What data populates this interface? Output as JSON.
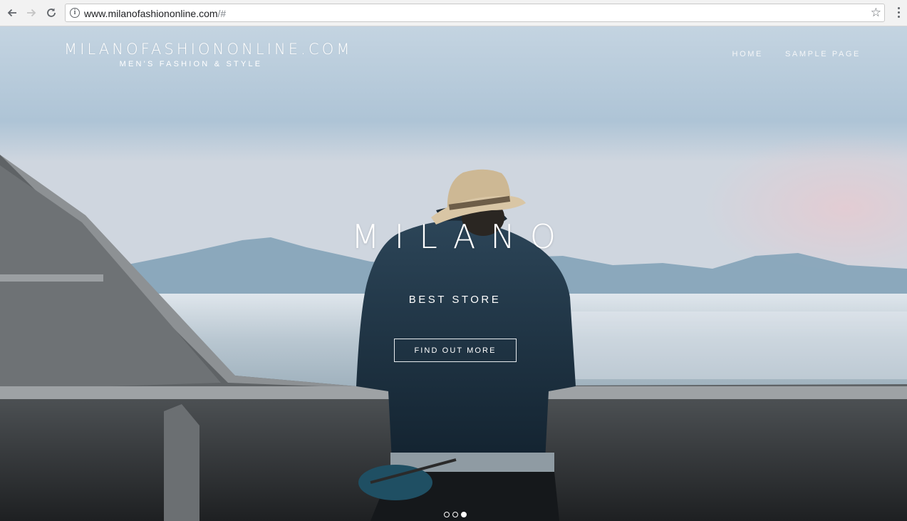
{
  "browser": {
    "url_main": "www.milanofashiononline.com",
    "url_suffix": "/#"
  },
  "site": {
    "title": "MILANOFASHIONONLINE.COM",
    "tagline": "MEN'S FASHION & STYLE",
    "nav": [
      {
        "label": "HOME"
      },
      {
        "label": "SAMPLE PAGE"
      }
    ]
  },
  "hero": {
    "title": "MILANO",
    "subtitle": "BEST STORE",
    "cta_label": "FIND OUT MORE",
    "slides_total": 3,
    "active_slide": 3
  },
  "icons": {
    "back": "arrow-left-icon",
    "forward": "arrow-right-icon",
    "reload": "reload-icon",
    "info": "info-icon",
    "bookmark": "star-icon",
    "menu": "kebab-menu-icon"
  }
}
